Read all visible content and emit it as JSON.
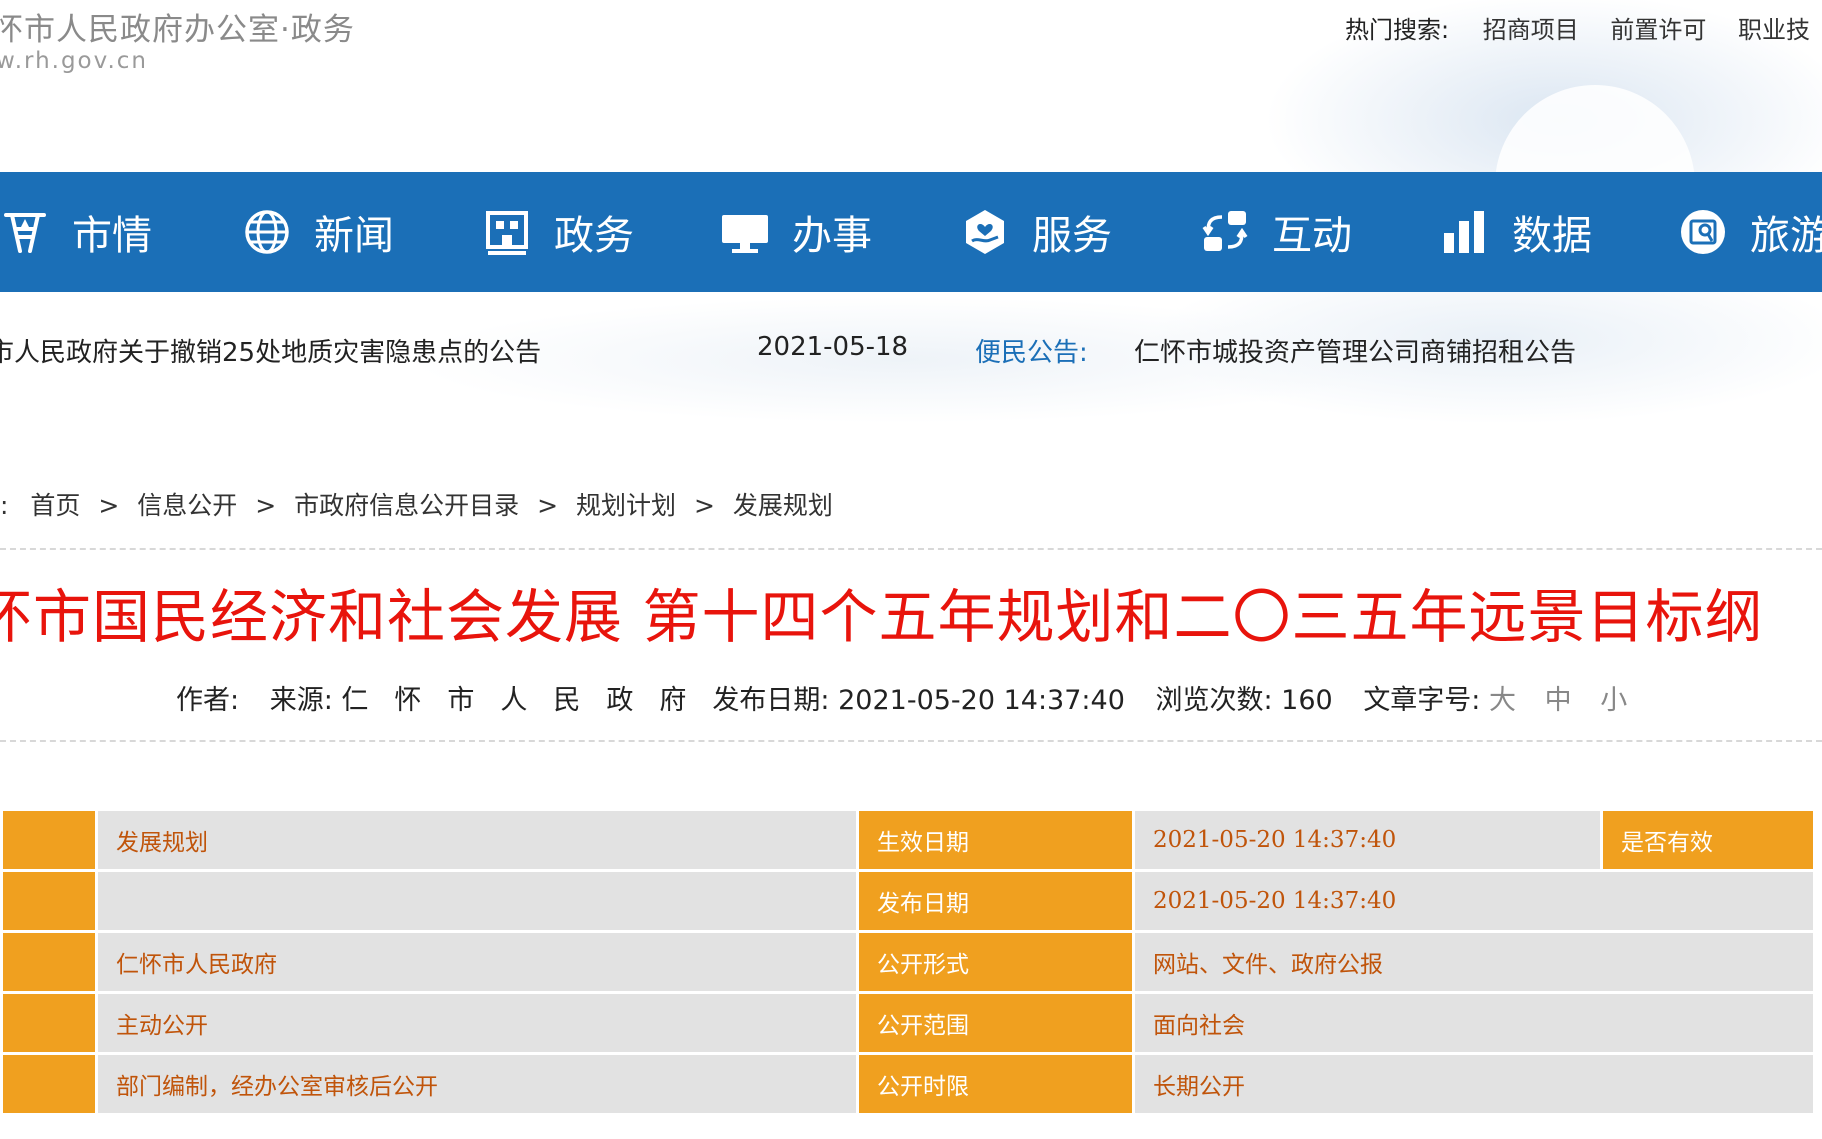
{
  "header": {
    "site_name": "怀市人民政府办公室·政务",
    "site_url": "w.rh.gov.cn",
    "hot_search_label": "热门搜索:",
    "hot_keywords": [
      "招商项目",
      "前置许可",
      "职业技"
    ]
  },
  "nav": [
    {
      "label": "市情",
      "icon": "city-landmark-icon"
    },
    {
      "label": "新闻",
      "icon": "globe-icon"
    },
    {
      "label": "政务",
      "icon": "building-icon"
    },
    {
      "label": "办事",
      "icon": "monitor-icon"
    },
    {
      "label": "服务",
      "icon": "hand-heart-icon"
    },
    {
      "label": "互动",
      "icon": "exchange-arrows-icon"
    },
    {
      "label": "数据",
      "icon": "bar-chart-icon"
    },
    {
      "label": "旅游",
      "icon": "map-camera-icon"
    }
  ],
  "notices": {
    "headline": "市人民政府关于撤销25处地质灾害隐患点的公告",
    "headline_date": "2021-05-18",
    "public_label": "便民公告:",
    "public_text": "仁怀市城投资产管理公司商铺招租公告"
  },
  "breadcrumb": {
    "prefix": ":",
    "items": [
      "首页",
      "信息公开",
      "市政府信息公开目录",
      "规划计划",
      "发展规划"
    ],
    "separator": ">"
  },
  "article": {
    "title": "怀市国民经济和社会发展 第十四个五年规划和二〇三五年远景目标纲",
    "author_label": "作者:",
    "source_label": "来源:",
    "source": "仁怀市人民政府",
    "publish_label": "发布日期:",
    "publish_date": "2021-05-20 14:37:40",
    "views_label": "浏览次数:",
    "views": "160",
    "fontsize_label": "文章字号:",
    "fontsize_options": [
      "大",
      "中",
      "小"
    ]
  },
  "info_table": {
    "rows": [
      {
        "value": "发展规划",
        "label2": "生效日期",
        "value2": "2021-05-20 14:37:40",
        "label3": "是否有效"
      },
      {
        "value": "",
        "label2": "发布日期",
        "value2": "2021-05-20 14:37:40"
      },
      {
        "value": "仁怀市人民政府",
        "label2": "公开形式",
        "value2": "网站、文件、政府公报"
      },
      {
        "value": "主动公开",
        "label2": "公开范围",
        "value2": "面向社会"
      },
      {
        "value": "部门编制，经办公室审核后公开",
        "label2": "公开时限",
        "value2": "长期公开"
      }
    ]
  },
  "colors": {
    "nav_blue": "#1b6fb7",
    "title_red": "#e8140c",
    "table_orange": "#f0a01f",
    "table_gray": "#e2e2e2"
  }
}
